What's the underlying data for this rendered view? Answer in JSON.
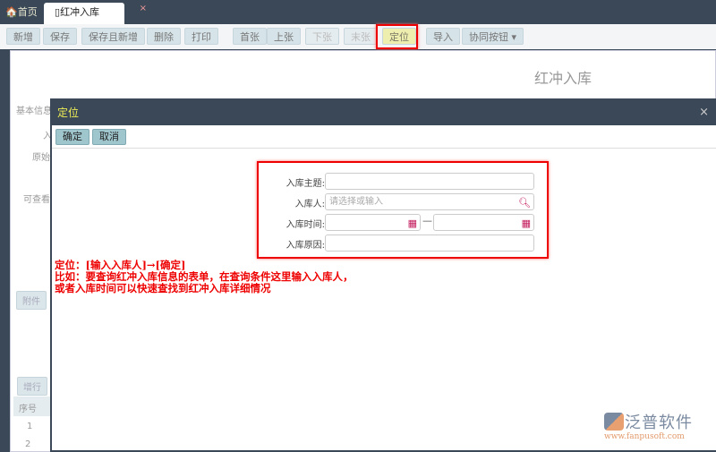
{
  "tabs": [
    {
      "label": "首页",
      "icon": "home-icon"
    },
    {
      "label": "红冲入库",
      "icon": "document-icon",
      "close": "×"
    }
  ],
  "toolbar": [
    "新增",
    "保存",
    "保存且新增",
    "删除",
    "打印",
    "首张",
    "上张",
    "下张",
    "末张",
    "定位",
    "导入",
    "协同按钮"
  ],
  "page": {
    "title": "红冲入库",
    "sidebar": [
      "基本信息",
      "入",
      "原始",
      "可查看"
    ],
    "attach_button": "附件",
    "add_row_button": "增行",
    "table": {
      "header": "序号",
      "rows": [
        "1",
        "2"
      ]
    }
  },
  "dialog": {
    "title": "定位",
    "close": "×",
    "confirm": "确定",
    "cancel": "取消",
    "fields": [
      {
        "label": "入库主题:",
        "value": ""
      },
      {
        "label": "入库人:",
        "placeholder": "请选择或输入"
      },
      {
        "label": "入库时间:",
        "separator": "—"
      },
      {
        "label": "入库原因:",
        "value": ""
      }
    ]
  },
  "annotation": [
    "定位：[输入入库人]→[确定]",
    "比如：要查询红冲入库信息的表单，在查询条件这里输入入库人，",
    "或者入库时间可以快速查找到红冲入库详细情况"
  ],
  "logo": {
    "name": "泛普软件",
    "url": "www.fanpusoft.com"
  }
}
